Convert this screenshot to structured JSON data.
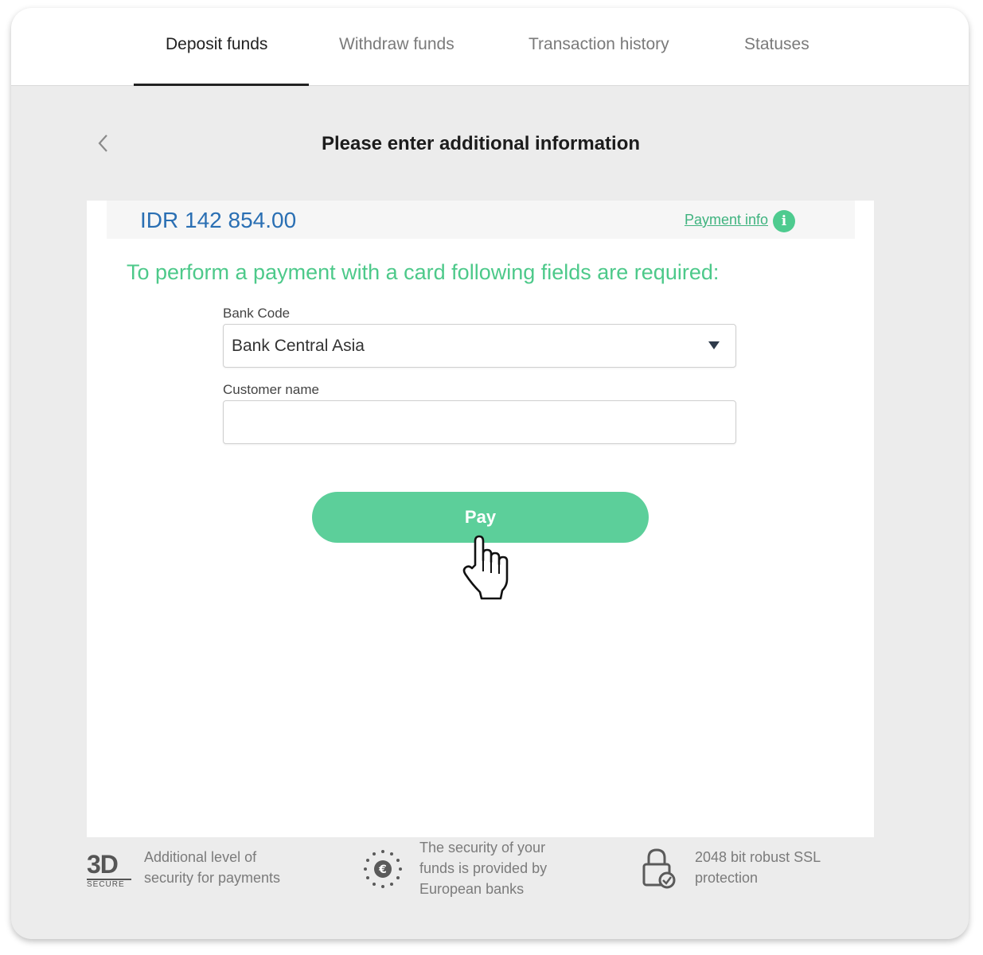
{
  "tabs": [
    {
      "label": "Deposit funds",
      "active": true
    },
    {
      "label": "Withdraw funds",
      "active": false
    },
    {
      "label": "Transaction history",
      "active": false
    },
    {
      "label": "Statuses",
      "active": false
    }
  ],
  "page_title": "Please enter additional information",
  "amount": "IDR 142 854.00",
  "payment_info_link": "Payment info",
  "required_message": "To perform a payment with a card following fields are required:",
  "form": {
    "bank_code_label": "Bank Code",
    "bank_code_value": "Bank Central Asia",
    "customer_name_label": "Customer name",
    "customer_name_value": ""
  },
  "pay_button": "Pay",
  "features": {
    "secure_3d": {
      "logo_big": "3D",
      "logo_small": "SECURE",
      "line1": "Additional level of",
      "line2": "security for payments"
    },
    "euro_banks": {
      "icon_glyph": "€",
      "line1": "The security of your",
      "line2": "funds is provided by",
      "line3": "European banks"
    },
    "ssl": {
      "line1": "2048 bit robust SSL",
      "line2": "protection"
    }
  },
  "colors": {
    "accent_green": "#5ccf9a",
    "amount_blue": "#2a6fb3"
  }
}
